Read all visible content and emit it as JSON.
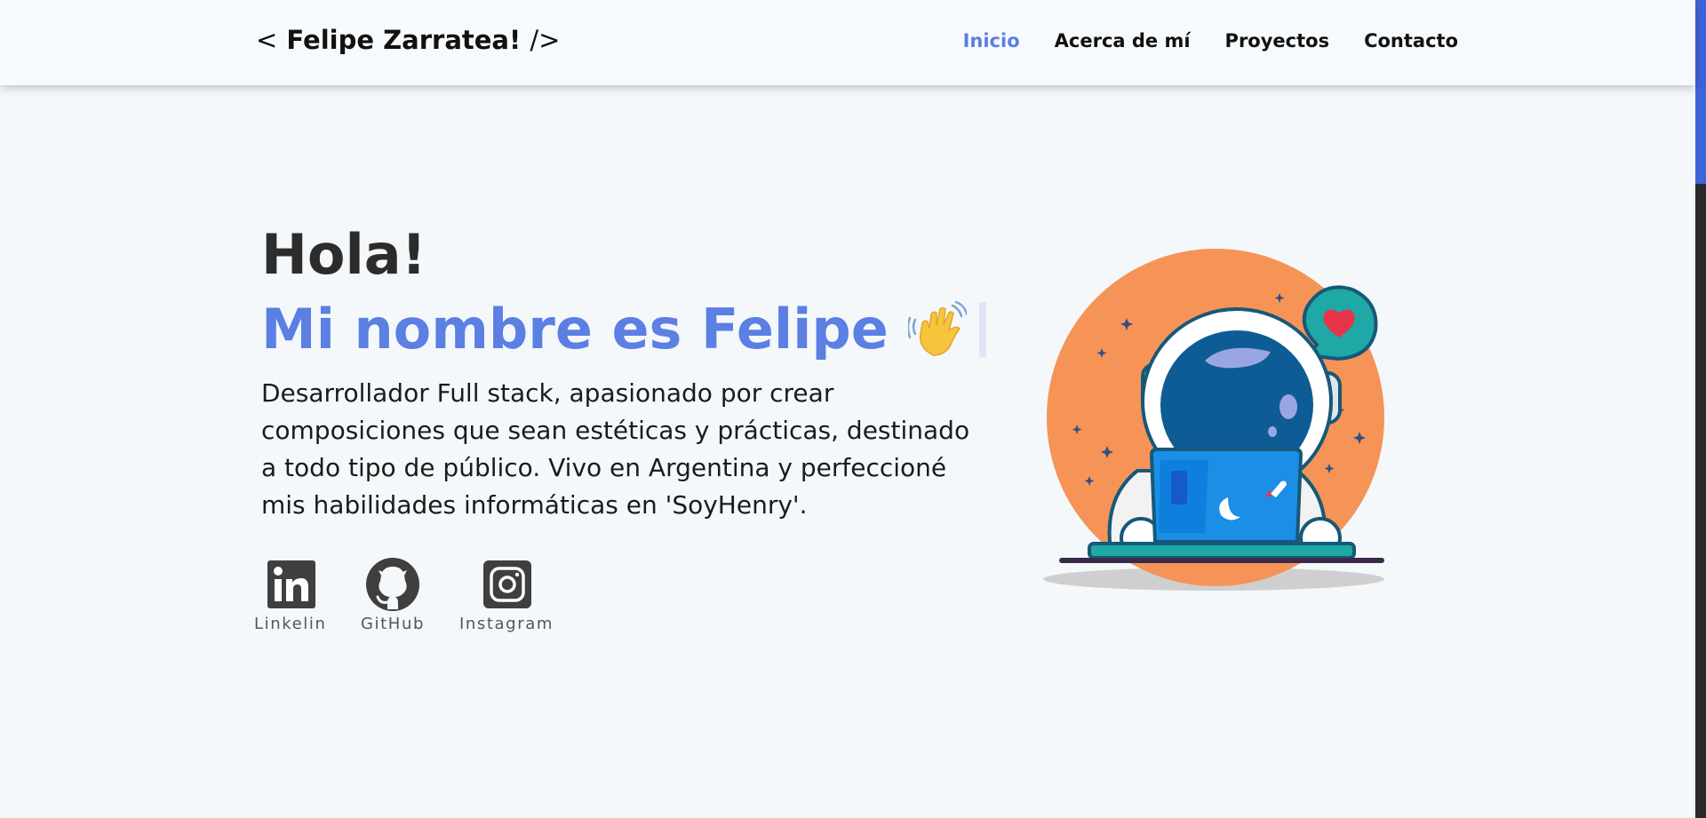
{
  "header": {
    "brand": {
      "open": "<",
      "name": "Felipe Zarratea!",
      "close": "/>"
    },
    "nav": [
      {
        "label": "Inicio",
        "active": true
      },
      {
        "label": "Acerca de mí",
        "active": false
      },
      {
        "label": "Proyectos",
        "active": false
      },
      {
        "label": "Contacto",
        "active": false
      }
    ]
  },
  "hero": {
    "greeting": "Hola!",
    "name_line": "Mi nombre es Felipe",
    "wave_icon": "waving-hand-icon",
    "description": "Desarrollador Full stack, apasionado por crear composiciones que sean estéticas y prácticas, destinado a todo tipo de público. Vivo en Argentina y perfeccioné mis habilidades informáticas en 'SoyHenry'."
  },
  "socials": [
    {
      "label": "Linkelin",
      "icon": "linkedin-icon"
    },
    {
      "label": "GitHub",
      "icon": "github-icon"
    },
    {
      "label": "Instagram",
      "icon": "instagram-icon"
    }
  ],
  "colors": {
    "accent": "#5b7fe2",
    "background": "#f4f8fb",
    "illustration_circle": "#f59456",
    "scroll_thumb": "#3f63d9"
  }
}
